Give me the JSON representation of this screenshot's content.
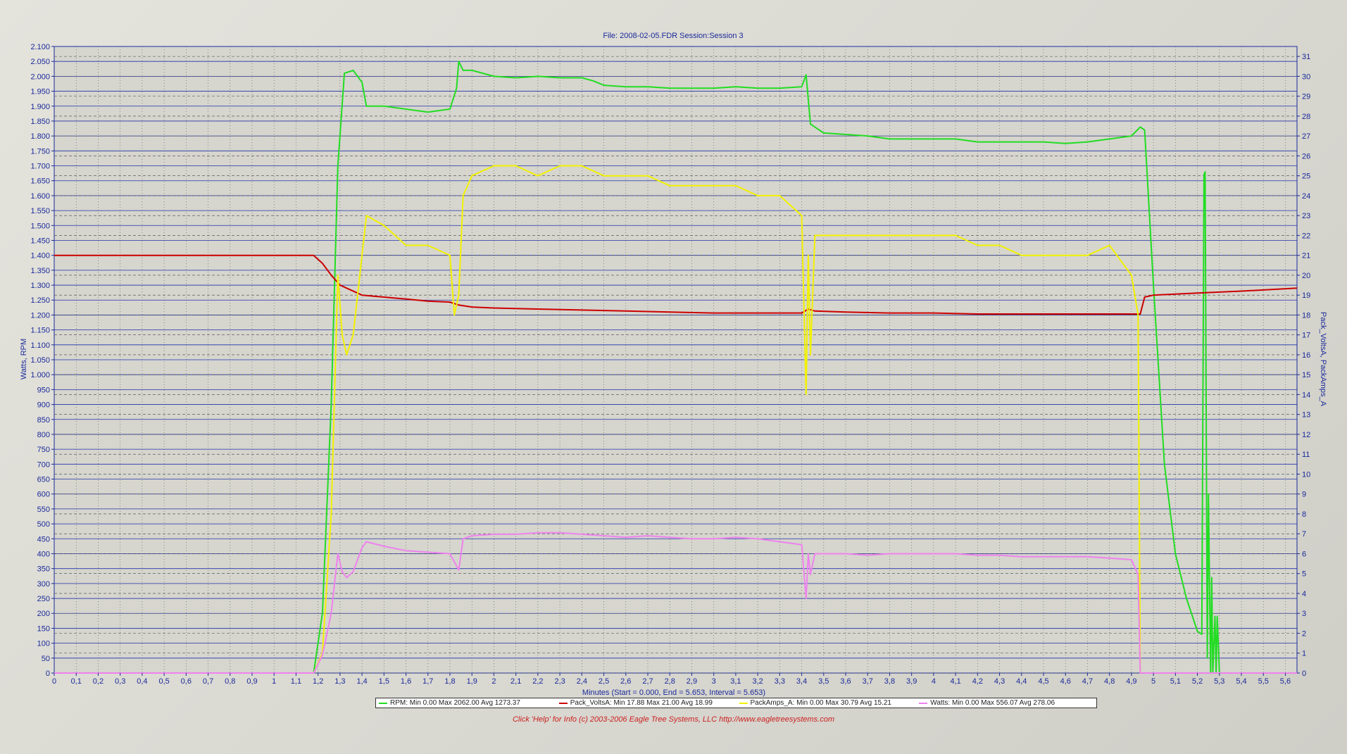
{
  "title": "File: 2008-02-05.FDR   Session:Session 3",
  "footer": "Click 'Help' for Info  (c) 2003-2006 Eagle Tree Systems, LLC      http://www.eagletreesystems.com",
  "legend": [
    {
      "label": "RPM:  Min 0.00   Max 2062.00   Avg 1273.37",
      "color": "#22dd22"
    },
    {
      "label": "Pack_VoltsA:  Min 17.88   Max 21.00   Avg 18.99",
      "color": "#cc0000"
    },
    {
      "label": "PackAmps_A:  Min 0.00   Max 30.79   Avg 15.21",
      "color": "#f2f200"
    },
    {
      "label": "Watts:  Min 0.00   Max 556.07   Avg 278.06",
      "color": "#ee82ee"
    }
  ],
  "chart_data": {
    "type": "line",
    "xlabel": "Minutes (Start = 0.000,  End = 5.653, Interval =  5.653)",
    "ylabel_left": "Watts, RPM",
    "ylabel_right": "Pack_VoltsA, PackAmps_A",
    "xlim": [
      0,
      5.653
    ],
    "ylim_left": [
      0,
      2100
    ],
    "ylim_right": [
      0,
      31.5
    ],
    "x_ticks": [
      "0",
      "0,1",
      "0,2",
      "0,3",
      "0,4",
      "0,5",
      "0,6",
      "0,7",
      "0,8",
      "0,9",
      "1",
      "1,1",
      "1,2",
      "1,3",
      "1,4",
      "1,5",
      "1,6",
      "1,7",
      "1,8",
      "1,9",
      "2",
      "2,1",
      "2,2",
      "2,3",
      "2,4",
      "2,5",
      "2,6",
      "2,7",
      "2,8",
      "2,9",
      "3",
      "3,1",
      "3,2",
      "3,3",
      "3,4",
      "3,5",
      "3,6",
      "3,7",
      "3,8",
      "3,9",
      "4",
      "4,1",
      "4,2",
      "4,3",
      "4,4",
      "4,5",
      "4,6",
      "4,7",
      "4,8",
      "4,9",
      "5",
      "5,1",
      "5,2",
      "5,3",
      "5,4",
      "5,5",
      "5,6"
    ],
    "y_left_ticks": [
      "0",
      "50",
      "100",
      "150",
      "200",
      "250",
      "300",
      "350",
      "400",
      "450",
      "500",
      "550",
      "600",
      "650",
      "700",
      "750",
      "800",
      "850",
      "900",
      "950",
      "1.000",
      "1.050",
      "1.100",
      "1.150",
      "1.200",
      "1.250",
      "1.300",
      "1.350",
      "1.400",
      "1.450",
      "1.500",
      "1.550",
      "1.600",
      "1.650",
      "1.700",
      "1.750",
      "1.800",
      "1.850",
      "1.900",
      "1.950",
      "2.000",
      "2.050",
      "2.100"
    ],
    "y_right_ticks": [
      "0",
      "1",
      "2",
      "3",
      "4",
      "5",
      "6",
      "7",
      "8",
      "9",
      "10",
      "11",
      "12",
      "13",
      "14",
      "15",
      "16",
      "17",
      "18",
      "19",
      "20",
      "21",
      "22",
      "23",
      "24",
      "25",
      "26",
      "27",
      "28",
      "29",
      "30",
      "31"
    ],
    "grid": true,
    "legend_position": "bottom",
    "series": [
      {
        "name": "RPM",
        "axis": "left",
        "color": "#22dd22",
        "x": [
          0,
          1.18,
          1.22,
          1.26,
          1.29,
          1.32,
          1.36,
          1.4,
          1.42,
          1.5,
          1.6,
          1.7,
          1.8,
          1.83,
          1.84,
          1.86,
          1.9,
          2.0,
          2.1,
          2.2,
          2.3,
          2.4,
          2.45,
          2.5,
          2.6,
          2.7,
          2.8,
          2.9,
          3.0,
          3.1,
          3.2,
          3.3,
          3.4,
          3.42,
          3.44,
          3.5,
          3.6,
          3.7,
          3.8,
          3.9,
          4.0,
          4.1,
          4.2,
          4.3,
          4.4,
          4.5,
          4.6,
          4.7,
          4.8,
          4.9,
          4.94,
          4.96,
          5.0,
          5.05,
          5.1,
          5.15,
          5.2,
          5.22,
          5.23,
          5.235,
          5.245,
          5.25,
          5.26,
          5.265,
          5.27,
          5.28,
          5.285,
          5.29,
          5.3,
          5.653
        ],
        "y": [
          0,
          0,
          200,
          900,
          1700,
          2010,
          2020,
          1980,
          1900,
          1900,
          1890,
          1880,
          1890,
          1960,
          2050,
          2020,
          2020,
          2000,
          1995,
          2000,
          1995,
          1995,
          1985,
          1970,
          1965,
          1965,
          1960,
          1960,
          1960,
          1965,
          1960,
          1960,
          1965,
          2005,
          1840,
          1810,
          1805,
          1800,
          1790,
          1790,
          1790,
          1790,
          1780,
          1780,
          1780,
          1780,
          1775,
          1780,
          1790,
          1800,
          1830,
          1820,
          1300,
          700,
          400,
          250,
          140,
          130,
          1670,
          1680,
          50,
          600,
          0,
          320,
          0,
          190,
          0,
          190,
          0,
          0
        ]
      },
      {
        "name": "Pack_VoltsA",
        "axis": "right",
        "color": "#cc0000",
        "x": [
          0,
          1.18,
          1.22,
          1.26,
          1.3,
          1.34,
          1.4,
          1.5,
          1.6,
          1.7,
          1.8,
          1.84,
          1.9,
          2.0,
          2.2,
          2.4,
          2.6,
          2.8,
          3.0,
          3.2,
          3.4,
          3.43,
          3.46,
          3.6,
          3.8,
          4.0,
          4.2,
          4.4,
          4.6,
          4.8,
          4.94,
          4.96,
          5.0,
          5.2,
          5.4,
          5.653
        ],
        "y": [
          21.0,
          21.0,
          20.6,
          20.0,
          19.5,
          19.3,
          19.0,
          18.9,
          18.8,
          18.7,
          18.65,
          18.5,
          18.4,
          18.35,
          18.3,
          18.25,
          18.2,
          18.15,
          18.1,
          18.1,
          18.1,
          18.3,
          18.2,
          18.15,
          18.1,
          18.1,
          18.05,
          18.05,
          18.05,
          18.05,
          18.05,
          18.9,
          19.0,
          19.1,
          19.2,
          19.35
        ]
      },
      {
        "name": "PackAmps_A",
        "axis": "right",
        "color": "#f2f200",
        "x": [
          0,
          1.18,
          1.22,
          1.26,
          1.29,
          1.31,
          1.33,
          1.36,
          1.4,
          1.42,
          1.5,
          1.6,
          1.7,
          1.8,
          1.82,
          1.84,
          1.86,
          1.9,
          2.0,
          2.1,
          2.2,
          2.3,
          2.4,
          2.5,
          2.6,
          2.7,
          2.8,
          2.9,
          3.0,
          3.1,
          3.2,
          3.3,
          3.4,
          3.42,
          3.43,
          3.44,
          3.46,
          3.5,
          3.6,
          3.7,
          3.8,
          3.9,
          4.0,
          4.1,
          4.2,
          4.3,
          4.4,
          4.5,
          4.6,
          4.7,
          4.8,
          4.9,
          4.93,
          4.94,
          4.95,
          5.653
        ],
        "y": [
          0,
          0,
          1,
          8,
          20,
          17,
          16,
          17,
          21,
          23,
          22.5,
          21.5,
          21.5,
          21,
          18,
          19,
          24,
          25,
          25.5,
          25.5,
          25,
          25.5,
          25.5,
          25,
          25,
          25,
          24.5,
          24.5,
          24.5,
          24.5,
          24,
          24,
          23,
          14,
          21,
          16,
          22,
          22,
          22,
          22,
          22,
          22,
          22,
          22,
          21.5,
          21.5,
          21,
          21,
          21,
          21,
          21.5,
          20,
          18,
          0,
          0,
          0
        ]
      },
      {
        "name": "Watts",
        "axis": "left",
        "color": "#ee82ee",
        "x": [
          0,
          1.18,
          1.22,
          1.26,
          1.29,
          1.31,
          1.33,
          1.36,
          1.4,
          1.42,
          1.5,
          1.6,
          1.7,
          1.8,
          1.84,
          1.86,
          1.9,
          2.0,
          2.1,
          2.2,
          2.3,
          2.4,
          2.5,
          2.6,
          2.7,
          2.8,
          2.9,
          3.0,
          3.1,
          3.2,
          3.3,
          3.4,
          3.42,
          3.43,
          3.44,
          3.46,
          3.5,
          3.6,
          3.7,
          3.8,
          3.9,
          4.0,
          4.1,
          4.2,
          4.3,
          4.4,
          4.5,
          4.6,
          4.7,
          4.8,
          4.9,
          4.93,
          4.94,
          4.95,
          5.653
        ],
        "y": [
          0,
          0,
          60,
          200,
          400,
          340,
          320,
          340,
          420,
          440,
          425,
          410,
          405,
          400,
          345,
          450,
          460,
          465,
          465,
          470,
          470,
          465,
          460,
          455,
          460,
          455,
          450,
          450,
          455,
          450,
          440,
          430,
          250,
          400,
          330,
          400,
          400,
          400,
          395,
          400,
          400,
          400,
          400,
          395,
          395,
          390,
          390,
          390,
          390,
          385,
          380,
          330,
          0,
          0,
          0
        ]
      }
    ]
  }
}
